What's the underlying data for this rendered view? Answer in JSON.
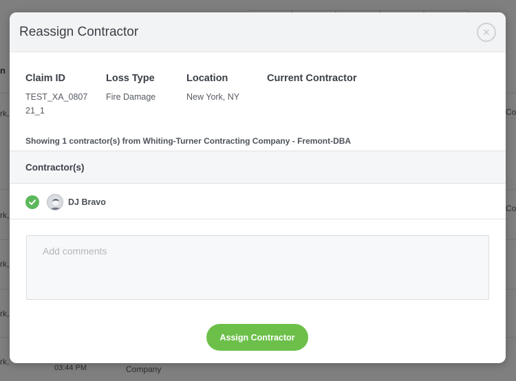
{
  "background": {
    "column_header_partial": "n",
    "rows_partial": [
      "rk,",
      "rk,",
      "rk,",
      "rk,",
      "rk,",
      "rk, ..."
    ],
    "right_partial": [
      "Co",
      "Co"
    ],
    "last_row": {
      "time": "03:44 PM",
      "company": "Company"
    }
  },
  "modal": {
    "title": "Reassign Contractor",
    "close_label": "×",
    "info": {
      "claim_id_label": "Claim ID",
      "claim_id_value": "TEST_XA_080721_1",
      "loss_type_label": "Loss Type",
      "loss_type_value": "Fire Damage",
      "location_label": "Location",
      "location_value": "New York, NY",
      "current_contractor_label": "Current Contractor"
    },
    "showing_text": "Showing 1 contractor(s) from Whiting-Turner Contracting Company - Fremont-DBA",
    "contractors_header": "Contractor(s)",
    "contractors": [
      {
        "name": "DJ Bravo",
        "selected": true,
        "icon": "check-circle-icon"
      }
    ],
    "comments_placeholder": "Add comments",
    "comments_value": "",
    "assign_button_label": "Assign Contractor"
  },
  "colors": {
    "accent_green": "#6cc04a",
    "check_green": "#5cb85c",
    "header_bg": "#f2f3f4"
  }
}
